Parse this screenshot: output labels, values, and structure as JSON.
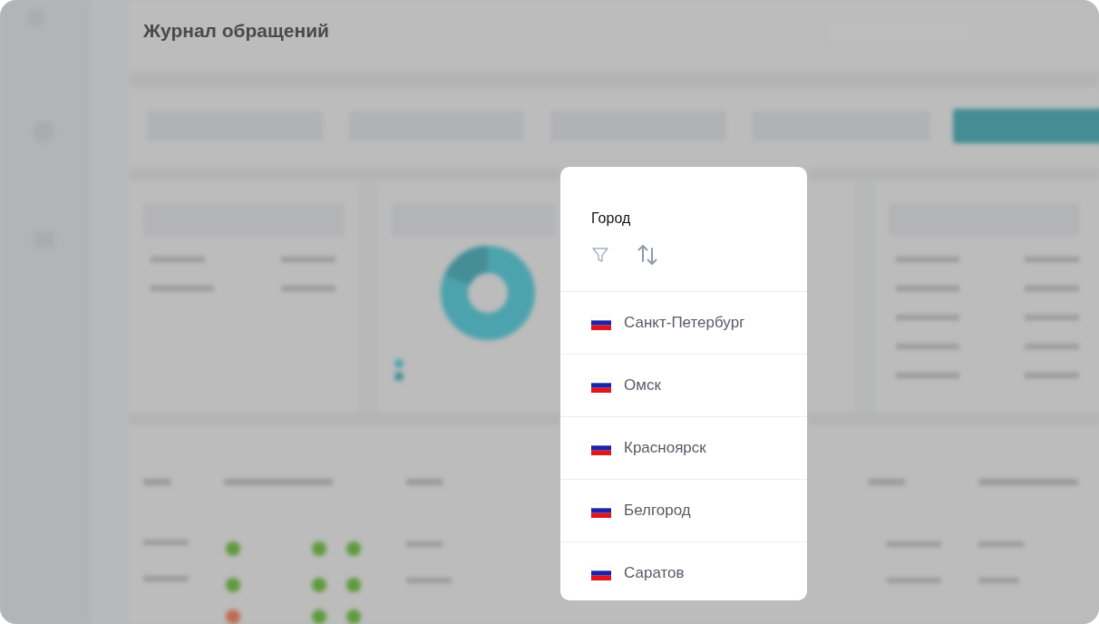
{
  "page_title": "Журнал обращений",
  "popup": {
    "title": "Город",
    "cities": [
      {
        "name": "Санкт-Петербург"
      },
      {
        "name": "Омск"
      },
      {
        "name": "Красноярск"
      },
      {
        "name": "Белгород"
      },
      {
        "name": "Саратов"
      }
    ]
  }
}
